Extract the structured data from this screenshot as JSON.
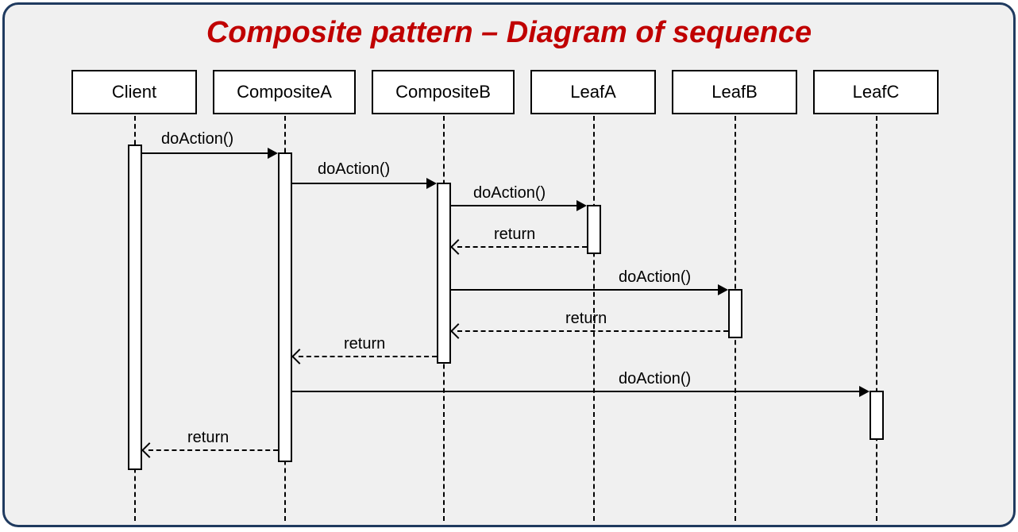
{
  "title": "Composite pattern – Diagram of sequence",
  "participants": {
    "client": "Client",
    "compositeA": "CompositeA",
    "compositeB": "CompositeB",
    "leafA": "LeafA",
    "leafB": "LeafB",
    "leafC": "LeafC"
  },
  "messages": {
    "client_to_compA": "doAction()",
    "compA_to_compB": "doAction()",
    "compB_to_leafA": "doAction()",
    "leafA_return": "return",
    "compB_to_leafB": "doAction()",
    "leafB_return": "return",
    "compB_return": "return",
    "compA_to_leafC": "doAction()",
    "compA_return": "return"
  }
}
